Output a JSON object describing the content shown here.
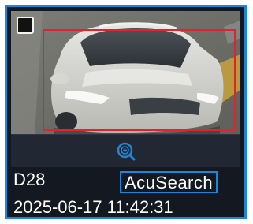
{
  "snapshot": {
    "channel": "D28",
    "search_button_label": "AcuSearch",
    "timestamp": "2025-06-17 11:42:31",
    "selected": false
  },
  "icons": {
    "checkbox": "checkbox-icon",
    "zoom": "zoom-in-icon"
  },
  "colors": {
    "accent": "#1e86d8",
    "detection_box": "#e0232c",
    "panel_background": "#141821",
    "toolbar_background": "#222734"
  }
}
